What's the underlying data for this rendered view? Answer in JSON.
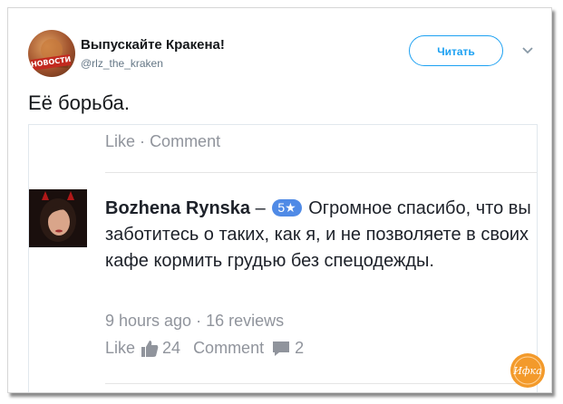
{
  "tweet": {
    "display_name": "Выпускайте Кракена!",
    "handle": "@rlz_the_kraken",
    "avatar_tag": "НОВОСТИ",
    "follow_label": "Читать",
    "text": "Её борьба."
  },
  "embedded_comment": {
    "top_like": "Like",
    "top_dot": "·",
    "top_comment": "Comment",
    "author": "Bozhena Rynska",
    "dash": "–",
    "rating_badge": "5★",
    "text": "Огромное спасибо, что вы заботитесь о таких, как я, и не позволяете в своих кафе кормить грудью без спецодежды.",
    "time": "9 hours ago",
    "meta_dot": "·",
    "reviews": "16 reviews",
    "like_label": "Like",
    "like_count": "24",
    "comment_label": "Comment",
    "comment_count": "2"
  },
  "watermark": {
    "logo_text": "Ифка"
  },
  "colors": {
    "accent": "#1da1f2",
    "badge": "#4f8ae6",
    "muted": "#90949c",
    "logo": "#f39a2b"
  }
}
